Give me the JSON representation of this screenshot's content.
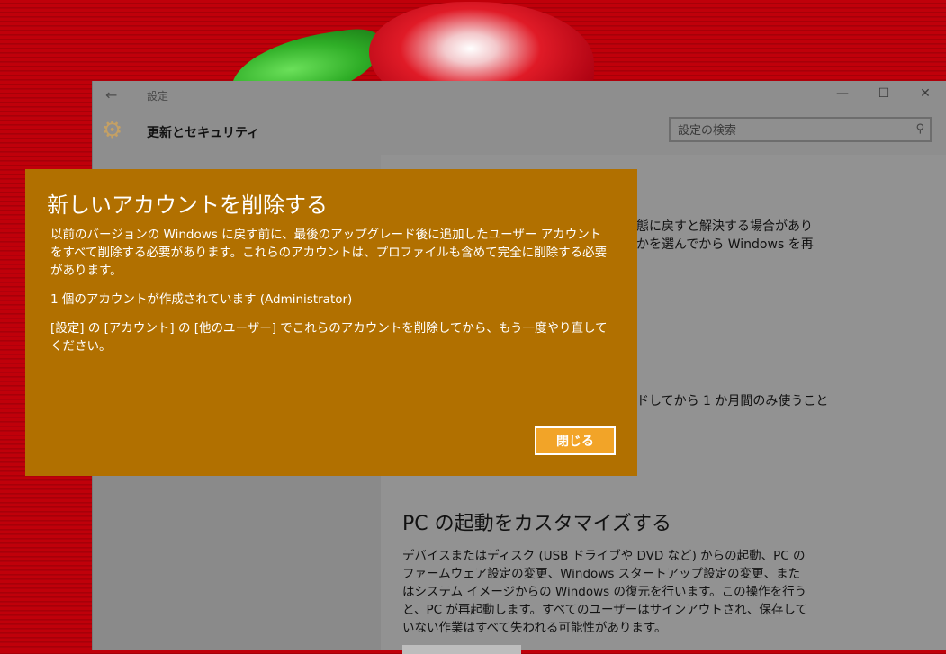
{
  "window": {
    "back_glyph": "←",
    "title": "設定",
    "minimize_glyph": "—",
    "maximize_glyph": "☐",
    "close_glyph": "✕"
  },
  "header": {
    "page_title": "更新とセキュリティ",
    "gear_glyph": "⚙",
    "search": {
      "placeholder": "設定の検索",
      "icon": "⚲"
    }
  },
  "main": {
    "background_fragments": [
      "態に戻すと解決する場合があり",
      "かを選んでから Windows を再",
      "ドしてから 1 か月間のみ使うこと"
    ],
    "section": {
      "title": "PC の起動をカスタマイズする",
      "body": "デバイスまたはディスク (USB ドライブや DVD など) からの起動、PC のファームウェア設定の変更、Windows スタートアップ設定の変更、またはシステム イメージからの Windows の復元を行います。この操作を行うと、PC が再起動します。すべてのユーザーはサインアウトされ、保存していない作業はすべて失われる可能性があります。"
    }
  },
  "dialog": {
    "title": "新しいアカウントを削除する",
    "paragraph1": "以前のバージョンの Windows に戻す前に、最後のアップグレード後に追加したユーザー アカウントをすべて削除する必要があります。これらのアカウントは、プロファイルも含めて完全に削除する必要があります。",
    "paragraph2": "1 個のアカウントが作成されています (Administrator)",
    "paragraph3": "[設定] の [アカウント] の [他のユーザー] でこれらのアカウントを削除してから、もう一度やり直してください。",
    "close_label": "閉じる",
    "accent_color": "#b17000",
    "button_color": "#f2a428"
  }
}
